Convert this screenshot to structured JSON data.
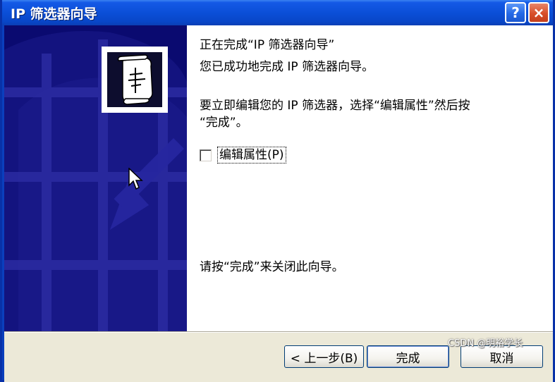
{
  "window": {
    "title": "IP 筛选器向导",
    "help_label": "?",
    "close_label": "×"
  },
  "content": {
    "heading": "正在完成“IP 筛选器向导”",
    "success_text": "您已成功地完成 IP 筛选器向导。",
    "instruction_line1": "要立即编辑您的 IP 筛选器，选择“编辑属性”然后按",
    "instruction_line2": "“完成”。",
    "checkbox_label": "编辑属性(P)",
    "checkbox_checked": false,
    "close_hint": "请按“完成”来关闭此向导。"
  },
  "buttons": {
    "back_label": "< 上一步(B)",
    "finish_label": "完成",
    "cancel_label": "取消"
  },
  "watermark": "CSDN @明裕学长",
  "colors": {
    "titlebar": "#0b4fd8",
    "banner": "#0a0a72",
    "dialog_face": "#ece9d8",
    "close_button": "#d84f2a"
  },
  "icons": {
    "banner_icon": "scroll-document-icon",
    "cursor": "mouse-pointer-icon"
  }
}
